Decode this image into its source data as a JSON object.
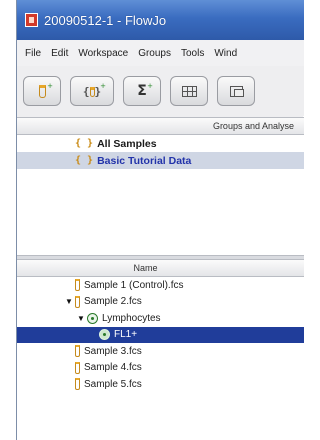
{
  "window": {
    "title": "20090512-1 - FlowJo"
  },
  "menu": [
    "File",
    "Edit",
    "Workspace",
    "Groups",
    "Tools",
    "Wind"
  ],
  "toolbar": {
    "buttons": [
      {
        "icon": "add-sample-icon"
      },
      {
        "icon": "add-group-icon"
      },
      {
        "icon": "add-statistic-icon",
        "glyph": "Σ"
      },
      {
        "icon": "table-editor-icon"
      },
      {
        "icon": "layout-editor-icon"
      }
    ]
  },
  "groups": {
    "header": "Groups and Analyse",
    "items": [
      {
        "label": "All Samples",
        "icon": "group-icon",
        "selected": false
      },
      {
        "label": "Basic Tutorial Data",
        "icon": "group-icon",
        "selected": true
      }
    ]
  },
  "samples": {
    "header": "Name",
    "rows": [
      {
        "label": "Sample 1 (Control).fcs",
        "type": "sample"
      },
      {
        "label": "Sample 2.fcs",
        "type": "sample",
        "expanded": true
      },
      {
        "label": "Lymphocytes",
        "type": "gate",
        "expanded": true
      },
      {
        "label": "FL1+",
        "type": "gate",
        "selected": true
      },
      {
        "label": "Sample 3.fcs",
        "type": "sample"
      },
      {
        "label": "Sample 4.fcs",
        "type": "sample"
      },
      {
        "label": "Sample 5.fcs",
        "type": "sample"
      }
    ]
  },
  "colors": {
    "title_bar": "#3a6cc0",
    "selection": "#203d9a",
    "group_selection": "#cfd6e4",
    "group_label_selected": "#2233aa",
    "tube": "#c58a1c",
    "gate": "#2a7a2a"
  }
}
